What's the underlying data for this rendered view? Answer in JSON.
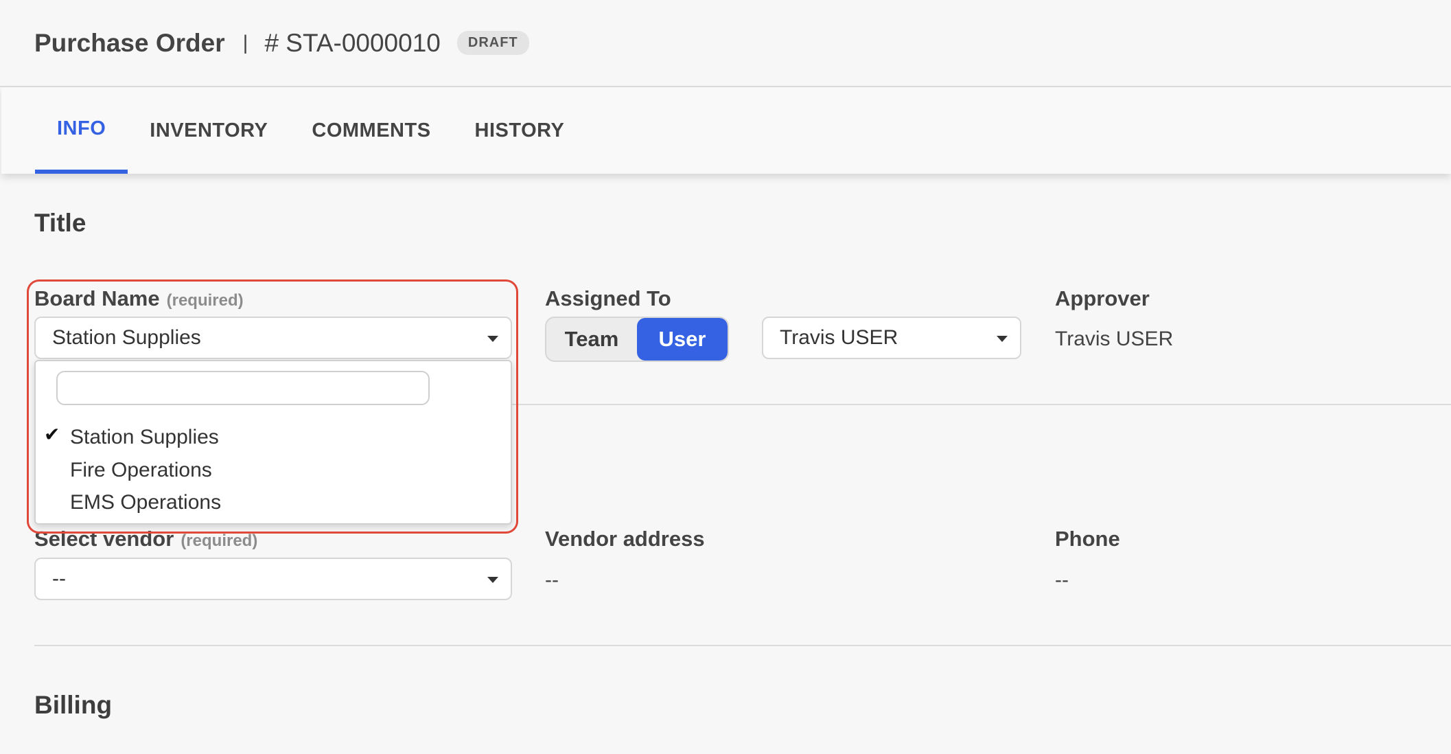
{
  "header": {
    "title": "Purchase Order",
    "separator": "|",
    "number": "# STA-0000010",
    "status": "DRAFT"
  },
  "tabs": [
    {
      "label": "INFO",
      "active": true
    },
    {
      "label": "INVENTORY",
      "active": false
    },
    {
      "label": "COMMENTS",
      "active": false
    },
    {
      "label": "HISTORY",
      "active": false
    }
  ],
  "sections": {
    "title": "Title",
    "billing": "Billing"
  },
  "board": {
    "label": "Board Name",
    "required": "(required)",
    "value": "Station Supplies",
    "search_value": "",
    "options": [
      {
        "label": "Station Supplies",
        "selected": true
      },
      {
        "label": "Fire Operations",
        "selected": false
      },
      {
        "label": "EMS Operations",
        "selected": false
      }
    ]
  },
  "assigned": {
    "label": "Assigned To",
    "team_label": "Team",
    "user_label": "User",
    "selected_mode": "User",
    "user_value": "Travis USER"
  },
  "approver": {
    "label": "Approver",
    "value": "Travis USER"
  },
  "vendor": {
    "label": "Select vendor",
    "required": "(required)",
    "value": "--",
    "address_label": "Vendor address",
    "address_value": "--",
    "phone_label": "Phone",
    "phone_value": "--"
  },
  "colors": {
    "accent": "#3562e3",
    "highlight": "#e0493a"
  },
  "icons": {
    "caret": "caret-down-icon",
    "check": "checkmark-icon"
  }
}
